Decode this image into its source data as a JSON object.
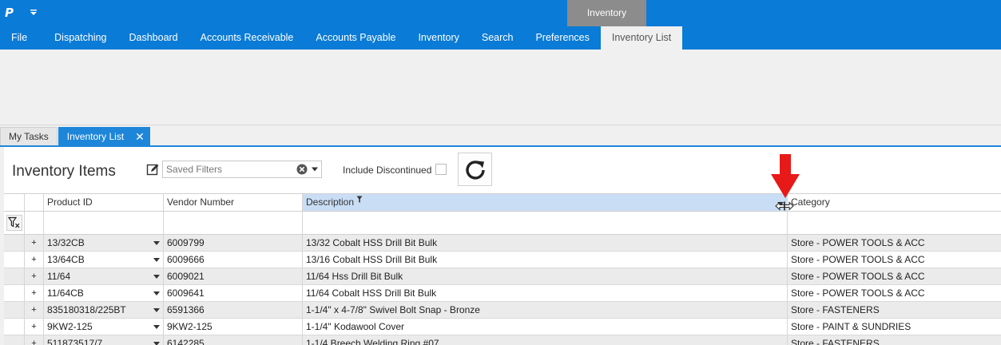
{
  "ribbon": {
    "logo": "P",
    "context_group": "Inventory",
    "tabs": [
      {
        "label": "File"
      },
      {
        "label": "Dispatching"
      },
      {
        "label": "Dashboard"
      },
      {
        "label": "Accounts Receivable"
      },
      {
        "label": "Accounts Payable"
      },
      {
        "label": "Inventory"
      },
      {
        "label": "Search"
      },
      {
        "label": "Preferences"
      },
      {
        "label": "Inventory List",
        "active": true
      }
    ],
    "accent_color": "#0a7bd6"
  },
  "doc_tabs": {
    "my_tasks": "My Tasks",
    "inventory_list": "Inventory List",
    "close": "✕"
  },
  "toolbar": {
    "title": "Inventory Items",
    "saved_filters_placeholder": "Saved Filters",
    "include_discontinued_label": "Include Discontinued",
    "include_discontinued_checked": false
  },
  "grid": {
    "columns": {
      "product_id": "Product ID",
      "vendor_number": "Vendor Number",
      "description": "Description",
      "category": "Category"
    },
    "rows": [
      {
        "product_id": "13/32CB",
        "vendor_number": "6009799",
        "description": "13/32 Cobalt HSS Drill Bit Bulk",
        "category": "Store - POWER TOOLS & ACC"
      },
      {
        "product_id": "13/64CB",
        "vendor_number": "6009666",
        "description": "13/16 Cobalt HSS Drill Bit Bulk",
        "category": "Store - POWER TOOLS & ACC"
      },
      {
        "product_id": "11/64",
        "vendor_number": "6009021",
        "description": "11/64 Hss Drill Bit Bulk",
        "category": "Store - POWER TOOLS & ACC"
      },
      {
        "product_id": "11/64CB",
        "vendor_number": "6009641",
        "description": "11/64 Cobalt HSS Drill Bit Bulk",
        "category": "Store - POWER TOOLS & ACC"
      },
      {
        "product_id": "835180318/225BT",
        "vendor_number": "6591366",
        "description": "1-1/4\" x 4-7/8\" Swivel Bolt Snap -  Bronze",
        "category": "Store - FASTENERS"
      },
      {
        "product_id": "9KW2-125",
        "vendor_number": "9KW2-125",
        "description": "1-1/4\" Kodawool Cover",
        "category": "Store - PAINT & SUNDRIES"
      },
      {
        "product_id": "511873517/7",
        "vendor_number": "6142285",
        "description": "1-1/4 Breech Welding Ring #07",
        "category": "Store - FASTENERS"
      }
    ],
    "expand_symbol": "+"
  }
}
